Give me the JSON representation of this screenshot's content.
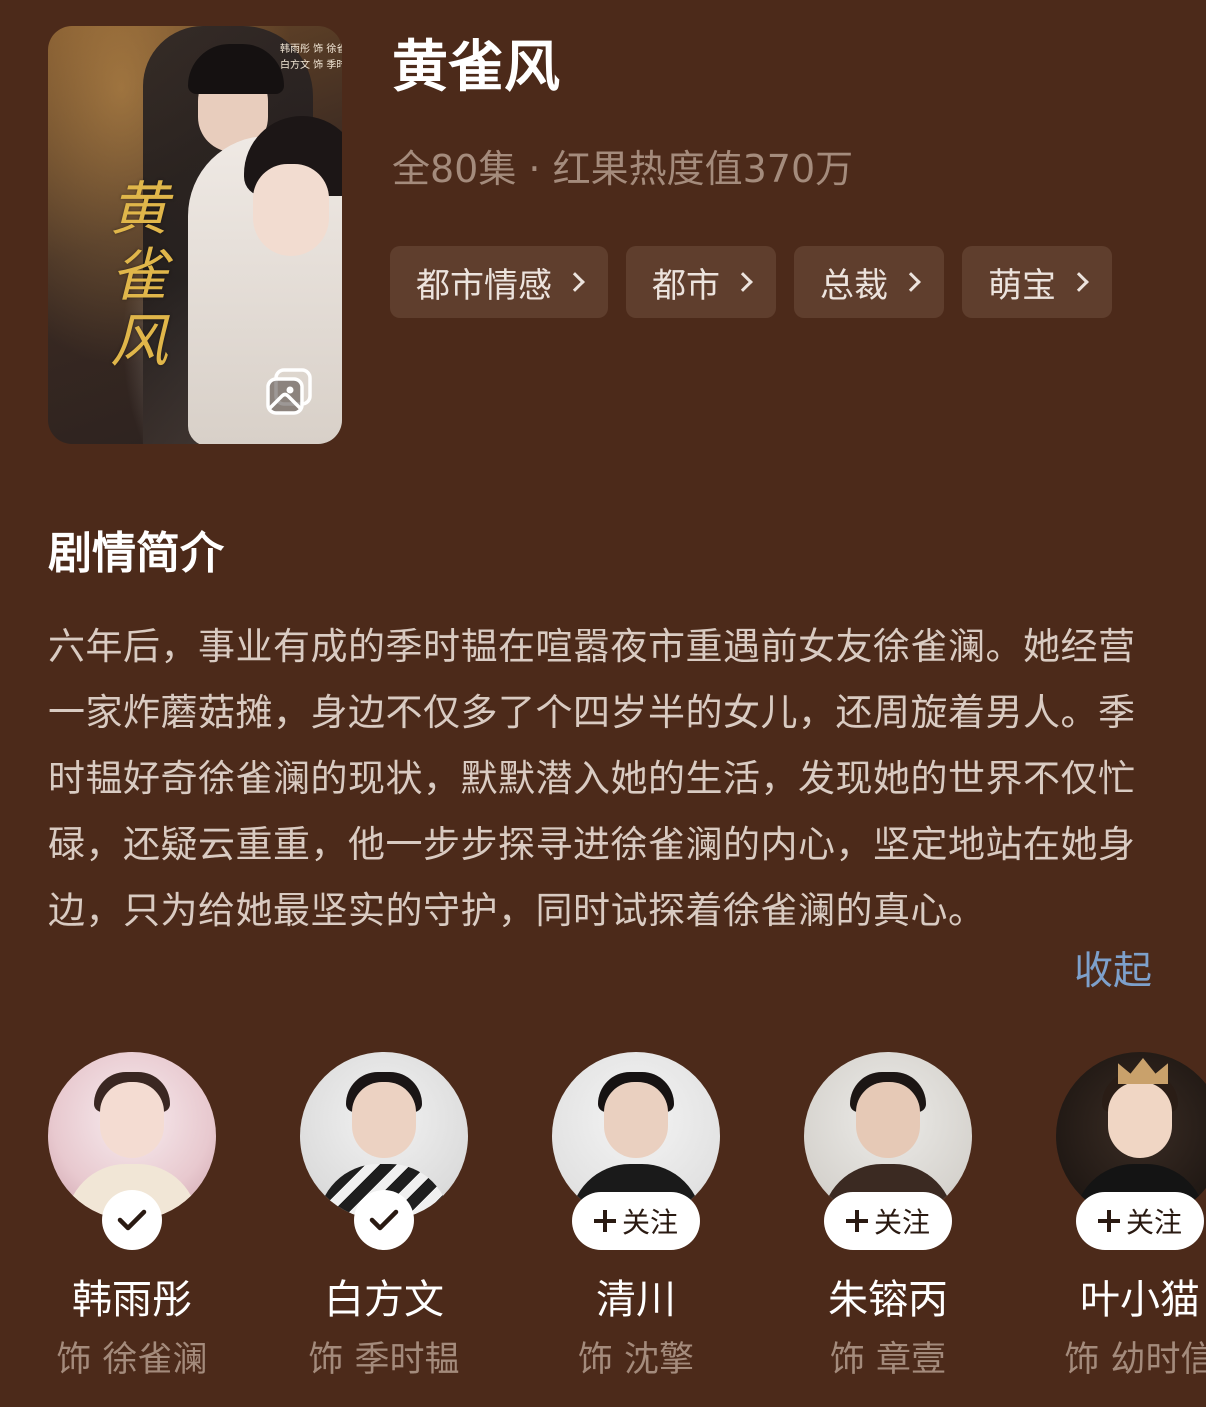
{
  "drama": {
    "title": "黄雀风",
    "meta": "全80集 · 红果热度值370万",
    "poster": {
      "title_art": "黄雀风",
      "credits": [
        "韩雨彤 饰 徐雀澜",
        "白方文 饰 季时韫"
      ]
    },
    "tags": [
      {
        "label": "都市情感"
      },
      {
        "label": "都市"
      },
      {
        "label": "总裁"
      },
      {
        "label": "萌宝"
      }
    ]
  },
  "synopsis": {
    "heading": "剧情简介",
    "text": "六年后，事业有成的季时韫在喧嚣夜市重遇前女友徐雀澜。她经营一家炸蘑菇摊，身边不仅多了个四岁半的女儿，还周旋着男人。季时韫好奇徐雀澜的现状，默默潜入她的生活，发现她的世界不仅忙碌，还疑云重重，他一步步探寻进徐雀澜的内心，坚定地站在她身边，只为给她最坚实的守护，同时试探着徐雀澜的真心。",
    "collapse_label": "收起"
  },
  "cast": [
    {
      "name": "韩雨彤",
      "role": "饰 徐雀澜",
      "followed": true,
      "follow_label": ""
    },
    {
      "name": "白方文",
      "role": "饰 季时韫",
      "followed": true,
      "follow_label": ""
    },
    {
      "name": "清川",
      "role": "饰 沈擎",
      "followed": false,
      "follow_label": "关注"
    },
    {
      "name": "朱镕丙",
      "role": "饰 章壹",
      "followed": false,
      "follow_label": "关注"
    },
    {
      "name": "叶小猫",
      "role": "饰 幼时信",
      "followed": false,
      "follow_label": "关注"
    }
  ],
  "colors": {
    "background": "#4c2a1a",
    "tag_bg": "#5f3e2d",
    "muted_text": "#a48b7c",
    "link": "#7da0cb"
  },
  "icons": {
    "gallery": "gallery-icon",
    "tag_chevron": "chevron-right-icon",
    "followed": "check-icon",
    "follow": "plus-icon"
  }
}
